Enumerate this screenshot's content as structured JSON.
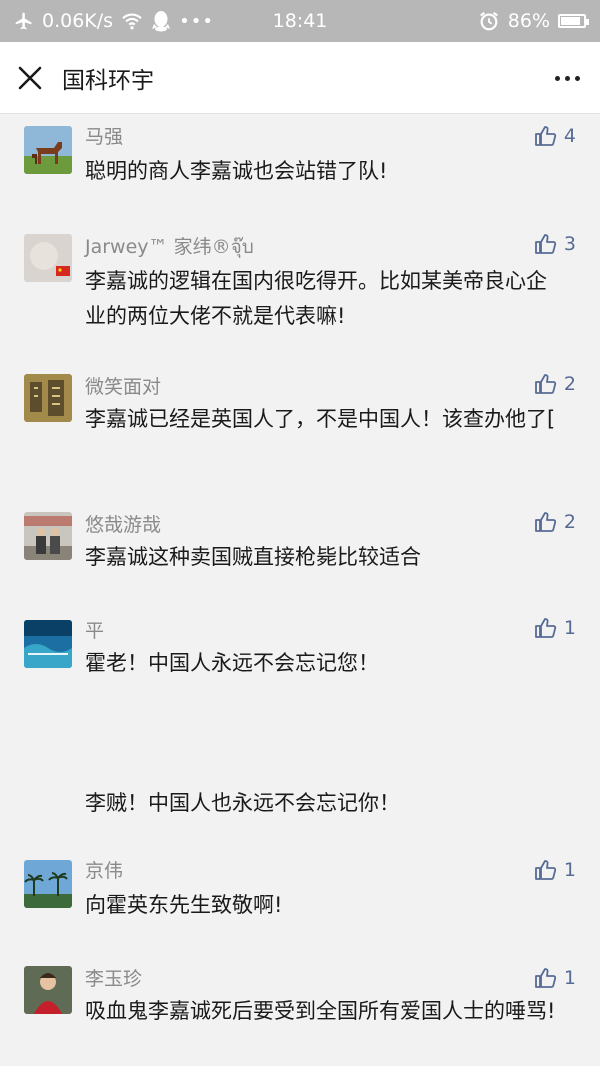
{
  "status_bar": {
    "speed": "0.06K/s",
    "time": "18:41",
    "battery": "86%",
    "icons": [
      "airplane-icon",
      "wifi-icon",
      "qq-icon",
      "alarm-icon",
      "battery-icon"
    ]
  },
  "nav": {
    "title": "国科环宇"
  },
  "colors": {
    "status_bar_bg": "#b7b7b7",
    "page_bg": "#f2f2f2",
    "like_blue": "#576b95",
    "name_gray": "#8a8a8a"
  },
  "comments": [
    {
      "name": "马强",
      "text": "聪明的商人李嘉诚也会站错了队!",
      "likes": "4"
    },
    {
      "name": "Jarwey™ 家纬®จุ๊บ",
      "text": "李嘉诚的逻辑在国内很吃得开。比如某美帝良心企业的两位大佬不就是代表嘛!",
      "likes": "3"
    },
    {
      "name": "微笑面对",
      "text": "李嘉诚已经是英国人了，不是中国人！该查办他了[",
      "likes": "2"
    },
    {
      "name": "悠哉游哉",
      "text": "李嘉诚这种卖国贼直接枪毙比较适合",
      "likes": "2"
    },
    {
      "name": "平",
      "text": "霍老！中国人永远不会忘记您！\n\n\n\n李贼！中国人也永远不会忘记你！",
      "likes": "1"
    },
    {
      "name": "京伟",
      "text": "向霍英东先生致敬啊!",
      "likes": "1"
    },
    {
      "name": "李玉珍",
      "text": "吸血鬼李嘉诚死后要受到全国所有爱国人士的唾骂!",
      "likes": "1"
    }
  ]
}
